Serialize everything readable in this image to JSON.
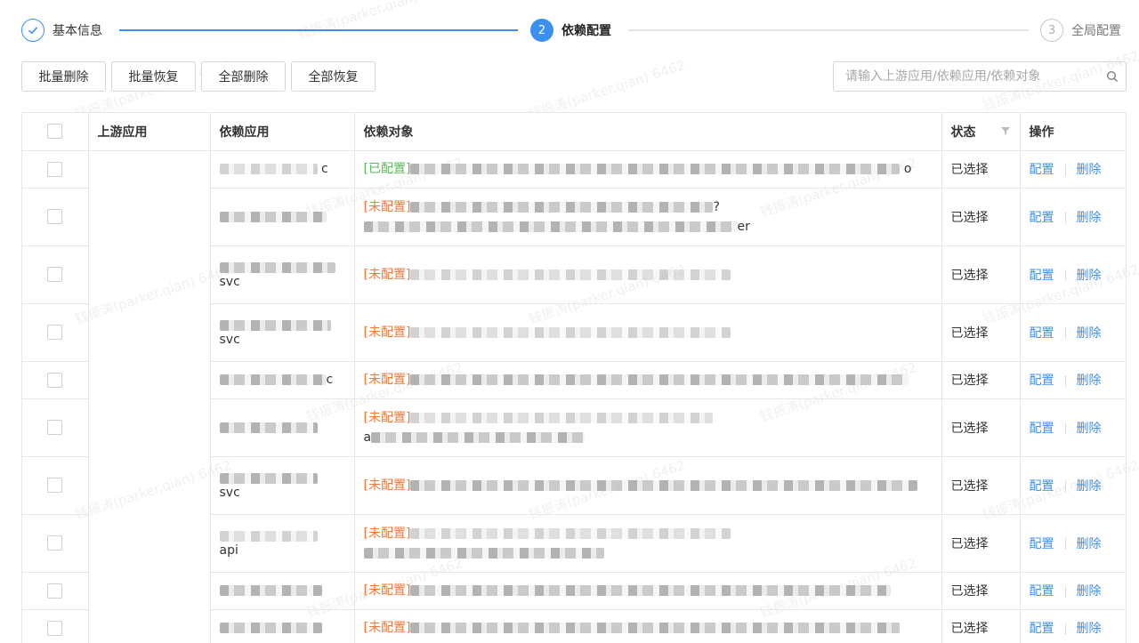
{
  "steps": [
    {
      "index": "1",
      "label": "基本信息",
      "state": "done"
    },
    {
      "index": "2",
      "label": "依赖配置",
      "state": "active"
    },
    {
      "index": "3",
      "label": "全局配置",
      "state": "wait"
    }
  ],
  "toolbar": {
    "batch_delete": "批量删除",
    "batch_restore": "批量恢复",
    "delete_all": "全部删除",
    "restore_all": "全部恢复"
  },
  "search": {
    "placeholder": "请输入上游应用/依赖应用/依赖对象"
  },
  "table": {
    "headers": {
      "upstream": "上游应用",
      "dep_app": "依赖应用",
      "dep_obj": "依赖对象",
      "status": "状态",
      "ops": "操作"
    },
    "rows": [
      {
        "app_suffix": "c",
        "tag": "[已配置]",
        "obj_line2": "",
        "obj_suffix": "o",
        "status": "已选择"
      },
      {
        "app_suffix": "",
        "tag": "[未配置]",
        "obj_line2": "er",
        "obj_suffix": "?",
        "status": "已选择"
      },
      {
        "app_suffix": "svc",
        "tag": "[未配置]",
        "obj_line2": "",
        "obj_suffix": "",
        "status": "已选择"
      },
      {
        "app_suffix": "svc",
        "tag": "[未配置]",
        "obj_line2": "",
        "obj_suffix": "",
        "status": "已选择"
      },
      {
        "app_suffix": "c",
        "tag": "[未配置]",
        "obj_line2": "",
        "obj_suffix": "",
        "status": "已选择"
      },
      {
        "app_suffix": "",
        "tag": "[未配置]",
        "obj_line2": "a",
        "obj_suffix": "",
        "status": "已选择"
      },
      {
        "app_suffix": "svc",
        "tag": "[未配置]",
        "obj_line2": "",
        "obj_suffix": "",
        "status": "已选择"
      },
      {
        "app_suffix": "api",
        "tag": "[未配置]",
        "obj_line2": "",
        "obj_suffix": "",
        "status": "已选择"
      },
      {
        "app_suffix": "",
        "tag": "[未配置]",
        "obj_line2": "",
        "obj_suffix": "",
        "status": "已选择"
      },
      {
        "app_suffix": "",
        "tag": "[未配置]",
        "obj_line2": "",
        "obj_suffix": "",
        "status": "已选择"
      }
    ],
    "op_config": "配置",
    "op_delete": "删除"
  },
  "watermark": "钱振涛(parker.qian) 6462",
  "colors": {
    "primary": "#3b8ff0",
    "configured": "#5cb85c",
    "unconfigured": "#f07a3a"
  }
}
